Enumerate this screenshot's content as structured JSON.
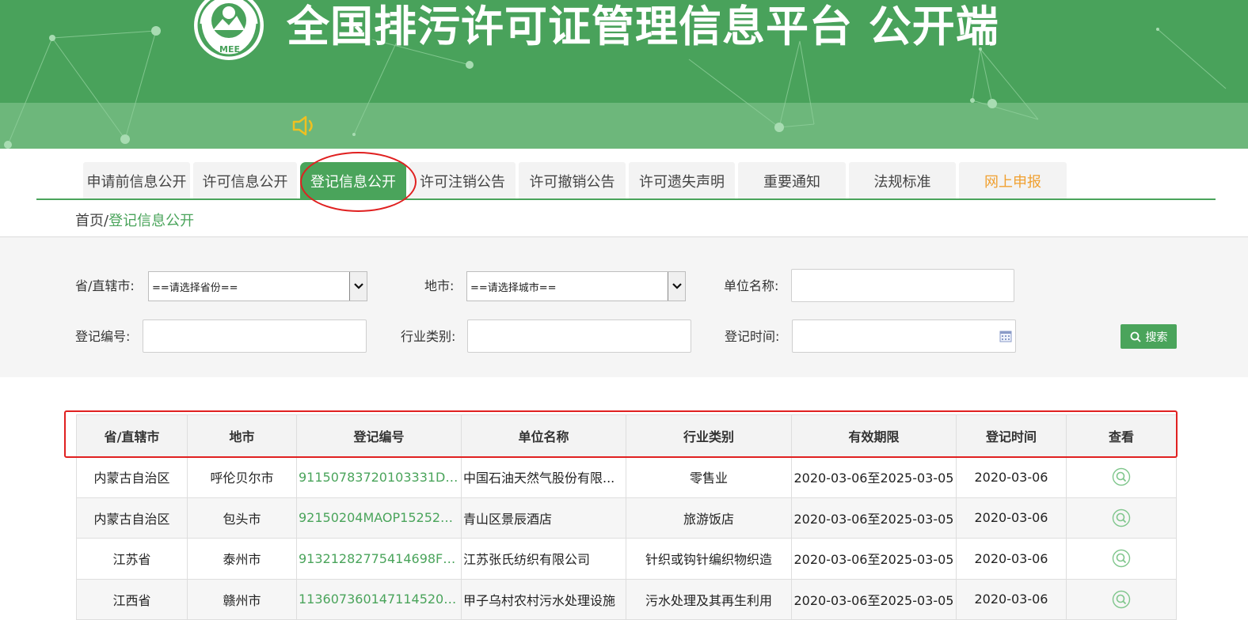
{
  "header": {
    "title": "全国排污许可证管理信息平台  公开端",
    "logo_icon": "mee-logo-icon",
    "logo_text": "MEE",
    "notice_icon": "speaker-icon"
  },
  "colors": {
    "brand_green": "#4aa45b",
    "banner_green": "#49a25b",
    "annotation_red": "#e02020",
    "orange_link": "#f0a030"
  },
  "nav": {
    "tabs": [
      {
        "label": "申请前信息公开"
      },
      {
        "label": "许可信息公开"
      },
      {
        "label": "登记信息公开",
        "active": true
      },
      {
        "label": "许可注销公告"
      },
      {
        "label": "许可撤销公告"
      },
      {
        "label": "许可遗失声明"
      },
      {
        "label": "重要通知"
      },
      {
        "label": "法规标准"
      },
      {
        "label": "网上申报"
      }
    ]
  },
  "breadcrumb": {
    "home": "首页",
    "separator": "/",
    "current": "登记信息公开"
  },
  "filter": {
    "province_label": "省/直辖市:",
    "province_value": "==请选择省份==",
    "city_label": "地市:",
    "city_value": "==请选择城市==",
    "company_label": "单位名称:",
    "reg_no_label": "登记编号:",
    "industry_label": "行业类别:",
    "reg_time_label": "登记时间:",
    "search_label": "搜索"
  },
  "table": {
    "headers": [
      "省/直辖市",
      "地市",
      "登记编号",
      "单位名称",
      "行业类别",
      "有效期限",
      "登记时间",
      "查看"
    ],
    "rows": [
      [
        "内蒙古自治区",
        "呼伦贝尔市",
        "91150783720103331D00...",
        "中国石油天然气股份有限...",
        "零售业",
        "2020-03-06至2025-03-05",
        "2020-03-06"
      ],
      [
        "内蒙古自治区",
        "包头市",
        "92150204MAOP1525210...",
        "青山区景辰酒店",
        "旅游饭店",
        "2020-03-06至2025-03-05",
        "2020-03-06"
      ],
      [
        "江苏省",
        "泰州市",
        "91321282775414698F00...",
        "江苏张氏纺织有限公司",
        "针织或钩针编织物织造",
        "2020-03-06至2025-03-05",
        "2020-03-06"
      ],
      [
        "江西省",
        "赣州市",
        "11360736014711452000...",
        "甲子乌村农村污水处理设施",
        "污水处理及其再生利用",
        "2020-03-06至2025-03-05",
        "2020-03-06"
      ]
    ]
  }
}
